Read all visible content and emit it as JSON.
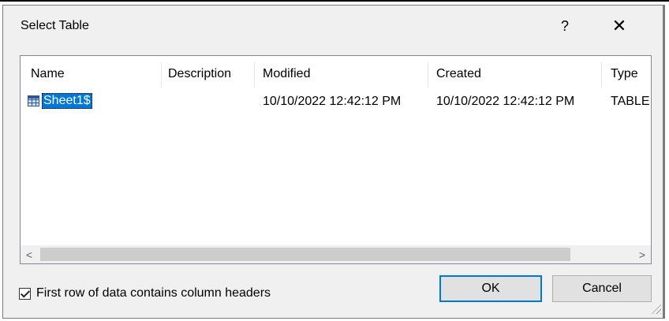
{
  "window": {
    "title": "Select Table",
    "help_label": "?",
    "close_label": "✕"
  },
  "table": {
    "columns": [
      "Name",
      "Description",
      "Modified",
      "Created",
      "Type"
    ],
    "rows": [
      {
        "name": "Sheet1$",
        "description": "",
        "modified": "10/10/2022 12:42:12 PM",
        "created": "10/10/2022 12:42:12 PM",
        "type": "TABLE"
      }
    ],
    "row_icon": "table-icon"
  },
  "scrollbar": {
    "left_arrow": "<",
    "right_arrow": ">"
  },
  "options": {
    "first_row_headers_label": "First row of data contains column headers",
    "first_row_headers_checked": true
  },
  "buttons": {
    "ok_label": "OK",
    "cancel_label": "Cancel"
  },
  "colors": {
    "selection": "#0078d7",
    "dialog_bg": "#f0f0f0"
  }
}
